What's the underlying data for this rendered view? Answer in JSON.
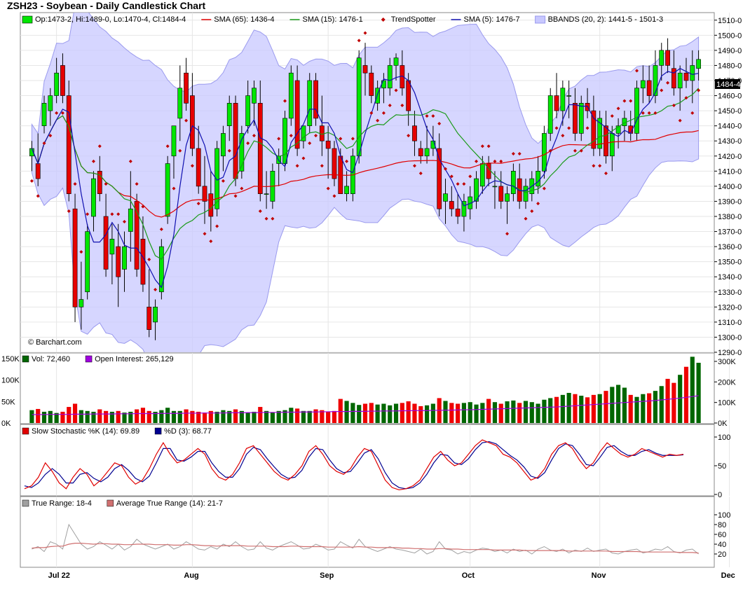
{
  "title": "ZSH23 - Soybean - Daily Candlestick Chart",
  "watermark": "© Barchart.com",
  "colors": {
    "up": "#00e600",
    "down": "#e60000",
    "bband_fill": "#c8c8ff",
    "bband_line": "#9a9aee",
    "sma65": "#e00000",
    "sma15": "#1a9a1a",
    "sma5": "#1010b0",
    "trend": "#c00000",
    "vol_up": "#006600",
    "vol_down": "#ee0000",
    "oi": "#a000e0",
    "stochK": "#e00000",
    "stochD": "#000090",
    "tr": "#a0a0a0",
    "atr": "#d07070",
    "grid": "#cccccc",
    "panel_bg": "#fafafa"
  },
  "legend_main": [
    {
      "text": "Op:1473-2, Hi:1489-0, Lo:1470-4, Cl:1484-4",
      "mark": "candle"
    },
    {
      "text": "SMA (65): 1436-4",
      "mark": "line",
      "color": "#e00000"
    },
    {
      "text": "SMA (15): 1476-1",
      "mark": "line",
      "color": "#1a9a1a"
    },
    {
      "text": "TrendSpotter",
      "mark": "diamond",
      "color": "#c00000"
    },
    {
      "text": "SMA (5): 1476-7",
      "mark": "line",
      "color": "#1010b0"
    },
    {
      "text": "BBANDS (20, 2): 1441-5 - 1501-3",
      "mark": "box",
      "color": "#9a9aee"
    }
  ],
  "legend_vol": [
    {
      "text": "Vol: 72,460",
      "color": "#006600"
    },
    {
      "text": "Open Interest: 265,129",
      "color": "#a000e0"
    }
  ],
  "legend_stoch": [
    {
      "text": "Slow Stochastic %K (14): 69.89",
      "color": "#e00000"
    },
    {
      "text": "%D (3): 68.77",
      "color": "#000090"
    }
  ],
  "legend_tr": [
    {
      "text": "True Range: 18-4",
      "color": "#a0a0a0"
    },
    {
      "text": "Average True Range (14): 21-7",
      "color": "#d07070"
    }
  ],
  "price_label": "1484-4",
  "chart_data": {
    "type": "candlestick",
    "symbol": "ZSH23",
    "price_axis": {
      "min": 1290,
      "max": 1515,
      "ticks": [
        "1290-0",
        "1300-0",
        "1310-0",
        "1320-0",
        "1330-0",
        "1340-0",
        "1350-0",
        "1360-0",
        "1370-0",
        "1380-0",
        "1390-0",
        "1400-0",
        "1410-0",
        "1420-0",
        "1430-0",
        "1440-0",
        "1450-0",
        "1460-0",
        "1470-0",
        "1480-0",
        "1490-0",
        "1500-0",
        "1510-0"
      ]
    },
    "vol_axis": {
      "left_ticks": [
        "0K",
        "50K",
        "100K",
        "150K"
      ],
      "left_max": 150,
      "right_ticks": [
        "0K",
        "100K",
        "200K",
        "300K"
      ],
      "right_max": 300
    },
    "stoch_axis": {
      "ticks": [
        "0",
        "50",
        "100"
      ]
    },
    "tr_axis": {
      "ticks": [
        "20",
        "40",
        "60",
        "80",
        "100"
      ],
      "max": 120
    },
    "x_labels": [
      {
        "label": "Jul 22",
        "index": 4
      },
      {
        "label": "Aug",
        "index": 26
      },
      {
        "label": "Sep",
        "index": 48
      },
      {
        "label": "Oct",
        "index": 71
      },
      {
        "label": "Nov",
        "index": 92
      },
      {
        "label": "Dec",
        "index": 113
      }
    ],
    "ohlc": [
      [
        1420,
        1430,
        1410,
        1425
      ],
      [
        1415,
        1435,
        1400,
        1405
      ],
      [
        1440,
        1460,
        1435,
        1455
      ],
      [
        1450,
        1465,
        1440,
        1460
      ],
      [
        1460,
        1485,
        1455,
        1475
      ],
      [
        1480,
        1488,
        1455,
        1460
      ],
      [
        1460,
        1470,
        1390,
        1395
      ],
      [
        1385,
        1395,
        1310,
        1320
      ],
      [
        1320,
        1350,
        1305,
        1325
      ],
      [
        1330,
        1375,
        1325,
        1370
      ],
      [
        1380,
        1410,
        1370,
        1405
      ],
      [
        1410,
        1420,
        1390,
        1395
      ],
      [
        1380,
        1395,
        1340,
        1345
      ],
      [
        1355,
        1375,
        1335,
        1365
      ],
      [
        1360,
        1375,
        1320,
        1340
      ],
      [
        1345,
        1370,
        1330,
        1360
      ],
      [
        1370,
        1410,
        1350,
        1385
      ],
      [
        1390,
        1395,
        1340,
        1345
      ],
      [
        1365,
        1380,
        1330,
        1335
      ],
      [
        1320,
        1345,
        1300,
        1305
      ],
      [
        1310,
        1325,
        1298,
        1320
      ],
      [
        1330,
        1365,
        1325,
        1360
      ],
      [
        1380,
        1420,
        1375,
        1415
      ],
      [
        1420,
        1440,
        1405,
        1440
      ],
      [
        1445,
        1480,
        1430,
        1465
      ],
      [
        1475,
        1485,
        1450,
        1455
      ],
      [
        1460,
        1475,
        1420,
        1425
      ],
      [
        1425,
        1440,
        1395,
        1400
      ],
      [
        1400,
        1420,
        1375,
        1390
      ],
      [
        1395,
        1410,
        1370,
        1380
      ],
      [
        1385,
        1430,
        1380,
        1425
      ],
      [
        1420,
        1440,
        1410,
        1435
      ],
      [
        1440,
        1460,
        1430,
        1455
      ],
      [
        1455,
        1460,
        1400,
        1405
      ],
      [
        1410,
        1440,
        1405,
        1435
      ],
      [
        1440,
        1470,
        1435,
        1460
      ],
      [
        1455,
        1470,
        1440,
        1465
      ],
      [
        1455,
        1470,
        1390,
        1395
      ],
      [
        1395,
        1410,
        1385,
        1395
      ],
      [
        1390,
        1415,
        1385,
        1410
      ],
      [
        1415,
        1425,
        1400,
        1420
      ],
      [
        1415,
        1450,
        1410,
        1445
      ],
      [
        1445,
        1480,
        1440,
        1475
      ],
      [
        1470,
        1480,
        1420,
        1425
      ],
      [
        1430,
        1440,
        1425,
        1440
      ],
      [
        1440,
        1475,
        1435,
        1470
      ],
      [
        1470,
        1475,
        1440,
        1445
      ],
      [
        1440,
        1460,
        1420,
        1430
      ],
      [
        1430,
        1440,
        1405,
        1425
      ],
      [
        1425,
        1430,
        1400,
        1405
      ],
      [
        1420,
        1425,
        1400,
        1395
      ],
      [
        1395,
        1410,
        1390,
        1400
      ],
      [
        1395,
        1425,
        1390,
        1420
      ],
      [
        1420,
        1490,
        1415,
        1485
      ],
      [
        1480,
        1495,
        1460,
        1475
      ],
      [
        1475,
        1480,
        1455,
        1460
      ],
      [
        1455,
        1470,
        1450,
        1465
      ],
      [
        1465,
        1475,
        1455,
        1470
      ],
      [
        1465,
        1485,
        1460,
        1480
      ],
      [
        1480,
        1488,
        1470,
        1485
      ],
      [
        1480,
        1490,
        1460,
        1465
      ],
      [
        1470,
        1475,
        1440,
        1450
      ],
      [
        1440,
        1450,
        1420,
        1430
      ],
      [
        1425,
        1430,
        1415,
        1420
      ],
      [
        1420,
        1440,
        1415,
        1425
      ],
      [
        1425,
        1440,
        1420,
        1430
      ],
      [
        1425,
        1435,
        1380,
        1385
      ],
      [
        1390,
        1405,
        1375,
        1395
      ],
      [
        1390,
        1400,
        1380,
        1385
      ],
      [
        1385,
        1395,
        1375,
        1380
      ],
      [
        1380,
        1395,
        1370,
        1390
      ],
      [
        1385,
        1400,
        1378,
        1393
      ],
      [
        1390,
        1410,
        1385,
        1405
      ],
      [
        1400,
        1420,
        1395,
        1415
      ],
      [
        1415,
        1420,
        1400,
        1405
      ],
      [
        1400,
        1410,
        1385,
        1400
      ],
      [
        1400,
        1410,
        1385,
        1390
      ],
      [
        1390,
        1400,
        1375,
        1395
      ],
      [
        1395,
        1415,
        1390,
        1410
      ],
      [
        1405,
        1415,
        1385,
        1390
      ],
      [
        1390,
        1405,
        1385,
        1400
      ],
      [
        1395,
        1410,
        1390,
        1405
      ],
      [
        1400,
        1420,
        1395,
        1410
      ],
      [
        1410,
        1440,
        1405,
        1435
      ],
      [
        1435,
        1465,
        1430,
        1460
      ],
      [
        1460,
        1475,
        1445,
        1450
      ],
      [
        1450,
        1470,
        1440,
        1465
      ],
      [
        1460,
        1470,
        1445,
        1460
      ],
      [
        1455,
        1465,
        1430,
        1435
      ],
      [
        1435,
        1460,
        1430,
        1455
      ],
      [
        1455,
        1465,
        1445,
        1450
      ],
      [
        1450,
        1460,
        1420,
        1425
      ],
      [
        1425,
        1450,
        1420,
        1445
      ],
      [
        1440,
        1450,
        1415,
        1420
      ],
      [
        1420,
        1440,
        1410,
        1435
      ],
      [
        1435,
        1445,
        1425,
        1440
      ],
      [
        1440,
        1450,
        1430,
        1445
      ],
      [
        1440,
        1450,
        1430,
        1435
      ],
      [
        1435,
        1470,
        1430,
        1465
      ],
      [
        1465,
        1480,
        1455,
        1470
      ],
      [
        1470,
        1480,
        1455,
        1460
      ],
      [
        1460,
        1490,
        1455,
        1480
      ],
      [
        1480,
        1495,
        1470,
        1490
      ],
      [
        1490,
        1498,
        1475,
        1480
      ],
      [
        1478,
        1490,
        1460,
        1465
      ],
      [
        1465,
        1480,
        1450,
        1475
      ],
      [
        1475,
        1485,
        1465,
        1470
      ],
      [
        1470,
        1490,
        1455,
        1480
      ],
      [
        1478,
        1490,
        1470,
        1484
      ]
    ],
    "volume_k": [
      32,
      35,
      28,
      30,
      25,
      28,
      40,
      48,
      32,
      30,
      28,
      34,
      30,
      28,
      30,
      26,
      28,
      34,
      38,
      30,
      28,
      32,
      38,
      30,
      30,
      34,
      30,
      28,
      26,
      30,
      28,
      32,
      30,
      34,
      30,
      26,
      28,
      40,
      30,
      26,
      30,
      32,
      38,
      36,
      30,
      30,
      34,
      32,
      28,
      30,
      60,
      55,
      50,
      45,
      48,
      50,
      46,
      48,
      44,
      48,
      50,
      54,
      48,
      42,
      44,
      48,
      62,
      55,
      50,
      48,
      50,
      52,
      46,
      50,
      60,
      52,
      48,
      54,
      56,
      50,
      55,
      52,
      48,
      58,
      62,
      65,
      70,
      75,
      72,
      68,
      64,
      70,
      72,
      80,
      90,
      95,
      88,
      70,
      65,
      72,
      74,
      80,
      92,
      110,
      100,
      120,
      140,
      165,
      150,
      170,
      180,
      160,
      150,
      165,
      175,
      170,
      168,
      160,
      155,
      158
    ],
    "open_interest_k": [
      42,
      42,
      42,
      43,
      43,
      43,
      43,
      44,
      44,
      44,
      45,
      45,
      45,
      45,
      46,
      46,
      46,
      47,
      47,
      47,
      47,
      48,
      48,
      48,
      48,
      49,
      49,
      49,
      50,
      50,
      50,
      50,
      51,
      51,
      51,
      52,
      52,
      52,
      53,
      53,
      53,
      54,
      54,
      54,
      55,
      55,
      55,
      56,
      56,
      57,
      57,
      57,
      58,
      58,
      58,
      59,
      59,
      60,
      60,
      60,
      61,
      61,
      62,
      62,
      62,
      63,
      63,
      64,
      64,
      65,
      66,
      66,
      67,
      68,
      69,
      70,
      71,
      72,
      73,
      74,
      75,
      76,
      77,
      78,
      79,
      80,
      82,
      84,
      86,
      88,
      90,
      92,
      94,
      96,
      98,
      100,
      102,
      104,
      106,
      108,
      110,
      112,
      115,
      118,
      121,
      124,
      128,
      132,
      136,
      140,
      145,
      150,
      155,
      160,
      165,
      175,
      185,
      195,
      200,
      205
    ],
    "stoch_k": [
      10,
      15,
      30,
      55,
      40,
      20,
      10,
      30,
      45,
      35,
      15,
      25,
      40,
      55,
      50,
      30,
      18,
      25,
      45,
      70,
      90,
      70,
      55,
      60,
      70,
      80,
      70,
      45,
      30,
      25,
      35,
      55,
      80,
      85,
      70,
      55,
      40,
      30,
      25,
      35,
      50,
      75,
      85,
      70,
      50,
      40,
      35,
      45,
      65,
      80,
      75,
      50,
      25,
      12,
      8,
      10,
      15,
      25,
      45,
      65,
      75,
      60,
      50,
      55,
      70,
      85,
      95,
      90,
      85,
      70,
      65,
      55,
      40,
      25,
      30,
      45,
      70,
      85,
      90,
      80,
      60,
      45,
      55,
      75,
      90,
      80,
      70,
      65,
      70,
      80,
      75,
      70,
      65,
      70,
      68,
      70
    ],
    "stoch_d": [
      15,
      12,
      20,
      35,
      45,
      35,
      20,
      20,
      35,
      38,
      28,
      22,
      30,
      45,
      52,
      42,
      28,
      22,
      32,
      55,
      80,
      80,
      60,
      58,
      65,
      75,
      75,
      55,
      40,
      30,
      30,
      45,
      70,
      82,
      78,
      62,
      48,
      35,
      28,
      30,
      42,
      65,
      80,
      78,
      60,
      45,
      38,
      40,
      55,
      72,
      78,
      62,
      38,
      20,
      12,
      10,
      12,
      20,
      35,
      55,
      70,
      68,
      55,
      52,
      62,
      78,
      90,
      92,
      88,
      78,
      68,
      60,
      48,
      32,
      28,
      38,
      60,
      80,
      88,
      85,
      70,
      52,
      50,
      65,
      82,
      85,
      75,
      68,
      68,
      75,
      78,
      72,
      68,
      68,
      68,
      69
    ],
    "true_range": [
      30,
      35,
      25,
      45,
      40,
      30,
      80,
      60,
      40,
      30,
      35,
      45,
      38,
      30,
      40,
      28,
      35,
      50,
      40,
      35,
      30,
      35,
      40,
      30,
      35,
      45,
      38,
      30,
      28,
      35,
      30,
      40,
      35,
      45,
      35,
      28,
      30,
      45,
      32,
      28,
      35,
      40,
      45,
      38,
      30,
      32,
      40,
      35,
      28,
      30,
      45,
      38,
      32,
      50,
      35,
      30,
      25,
      30,
      35,
      30,
      28,
      25,
      22,
      30,
      20,
      25,
      45,
      30,
      28,
      20,
      25,
      22,
      28,
      32,
      30,
      25,
      28,
      22,
      30,
      25,
      28,
      20,
      30,
      35,
      28,
      25,
      30,
      22,
      28,
      25,
      32,
      25,
      28,
      30,
      22,
      20,
      25,
      28,
      30,
      22,
      25,
      30,
      28,
      35,
      25,
      22,
      28,
      30,
      20,
      18
    ],
    "atr": [
      32,
      33,
      33,
      35,
      36,
      36,
      40,
      42,
      42,
      41,
      40,
      41,
      41,
      40,
      40,
      39,
      39,
      40,
      40,
      40,
      39,
      39,
      39,
      38,
      38,
      39,
      39,
      38,
      37,
      37,
      36,
      37,
      37,
      37,
      37,
      36,
      36,
      36,
      36,
      35,
      35,
      35,
      36,
      36,
      35,
      35,
      35,
      35,
      34,
      34,
      34,
      34,
      34,
      35,
      34,
      34,
      33,
      33,
      33,
      33,
      32,
      32,
      31,
      31,
      30,
      30,
      31,
      31,
      30,
      30,
      29,
      29,
      29,
      29,
      29,
      28,
      28,
      28,
      28,
      28,
      27,
      27,
      27,
      27,
      27,
      27,
      27,
      26,
      26,
      26,
      26,
      26,
      26,
      26,
      25,
      25,
      25,
      25,
      25,
      24,
      24,
      24,
      24,
      24,
      24,
      23,
      23,
      23,
      22,
      22
    ]
  }
}
